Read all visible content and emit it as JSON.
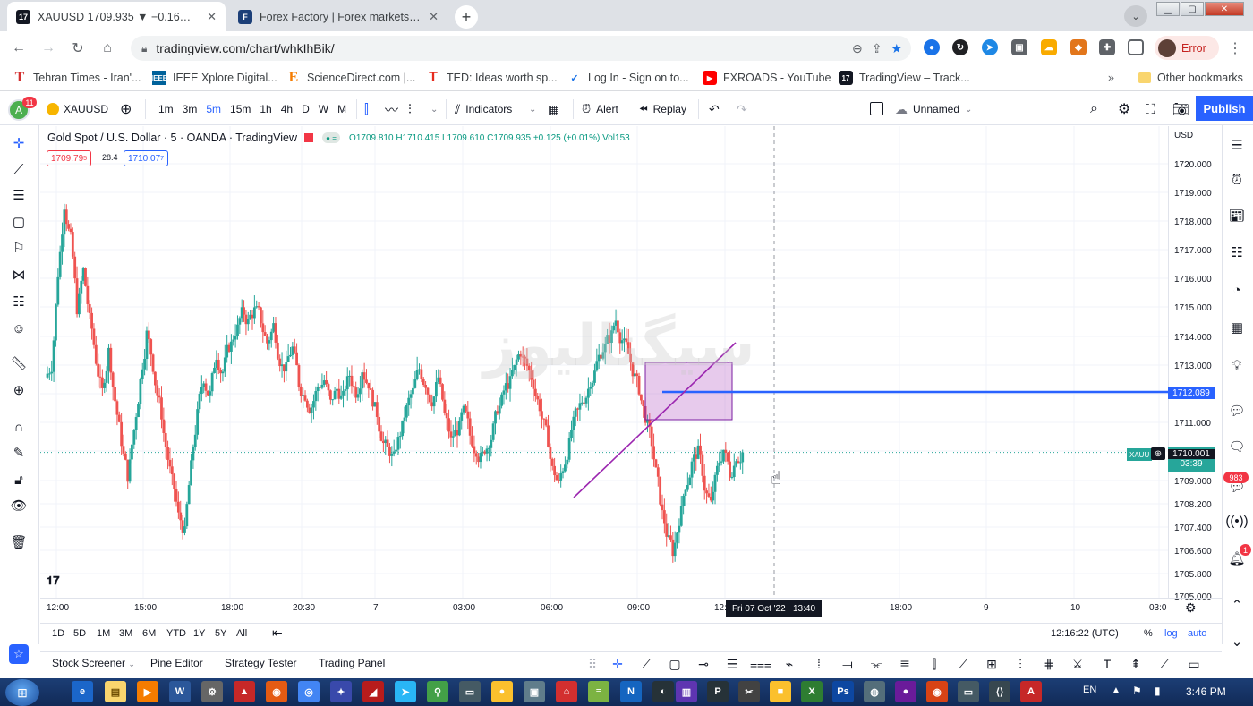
{
  "browser": {
    "tabs": [
      {
        "title": "XAUUSD 1709.935 ▼ −0.16% Un",
        "favicon": "tradingview-icon"
      },
      {
        "title": "Forex Factory | Forex markets for",
        "favicon": "forexfactory-icon"
      }
    ],
    "new_tab": "+",
    "url": "tradingview.com/chart/whkIhBik/",
    "profile_label": "Error",
    "bookmarks": [
      {
        "label": "Tehran Times - Iran'...",
        "icon": "T",
        "color": "#d32f2f"
      },
      {
        "label": "IEEE Xplore Digital...",
        "icon": "I",
        "color": "#00629b"
      },
      {
        "label": "ScienceDirect.com |...",
        "icon": "E",
        "color": "#f57c00"
      },
      {
        "label": "TED: Ideas worth sp...",
        "icon": "T",
        "color": "#e62b1e"
      },
      {
        "label": "Log In - Sign on to...",
        "icon": "✓",
        "color": "#1a73e8"
      },
      {
        "label": "FXROADS - YouTube",
        "icon": "▶",
        "color": "#ff0000"
      },
      {
        "label": "TradingView – Track...",
        "icon": "17",
        "color": "#131722"
      }
    ],
    "other_bookmarks": "Other bookmarks",
    "more": "»"
  },
  "tv_header": {
    "avatar_letter": "A",
    "avatar_badge": "11",
    "symbol": "XAUUSD",
    "intervals": [
      "1m",
      "3m",
      "5m",
      "15m",
      "1h",
      "4h",
      "D",
      "W",
      "M"
    ],
    "active_interval": "5m",
    "indicators": "Indicators",
    "alert": "Alert",
    "replay": "Replay",
    "layout_name": "Unnamed",
    "publish": "Publish"
  },
  "legend": {
    "title": "Gold Spot / U.S. Dollar · 5 · OANDA · TradingView",
    "open": "O1709.810",
    "high": "H1710.415",
    "low": "L1709.610",
    "close": "C1709.935",
    "change": "+0.125 (+0.01%)",
    "volume": "Vol153",
    "sell_price": "1709.79",
    "sell_sup": "5",
    "spread": "28.4",
    "buy_price": "1710.07",
    "buy_sup": "7"
  },
  "price_axis": {
    "currency": "USD",
    "labels": [
      "1720.000",
      "1719.000",
      "1718.000",
      "1717.000",
      "1716.000",
      "1715.000",
      "1714.000",
      "1713.000",
      "1712.000",
      "1711.000",
      "1710.000",
      "1709.000",
      "1708.200",
      "1707.400",
      "1706.600",
      "1705.800",
      "1705.000"
    ],
    "hline_label": "1712.089",
    "last_price": "1710.001",
    "countdown": "03:39",
    "symbol_tag": "XAUU"
  },
  "time_axis": {
    "labels": [
      "12:00",
      "15:00",
      "18:00",
      "20:30",
      "7",
      "03:00",
      "06:00",
      "09:00",
      "12:",
      "18:00",
      "9",
      "10",
      "03:0"
    ],
    "crosshair": "Fri 07 Oct '22   13:40"
  },
  "range_bar": {
    "ranges": [
      "1D",
      "5D",
      "1M",
      "3M",
      "6M",
      "YTD",
      "1Y",
      "5Y",
      "All"
    ],
    "time": "12:16:22 (UTC)",
    "percent": "%",
    "log": "log",
    "auto": "auto"
  },
  "bottom_tabs": [
    "Stock Screener",
    "Pine Editor",
    "Strategy Tester",
    "Trading Panel"
  ],
  "watermark": "سیگنالیوز",
  "right_badges": {
    "notifications": "983",
    "alerts": "1"
  },
  "taskbar": {
    "lang": "EN",
    "clock": "3:46 PM"
  },
  "colors": {
    "bull": "#26a69a",
    "bear": "#ef5350",
    "hline": "#2962ff",
    "trend": "#9c27b0",
    "box": "rgba(186,104,200,0.35)",
    "accent": "#2962ff"
  },
  "chart_data": {
    "type": "candlestick",
    "symbol": "XAUUSD",
    "timeframe": "5",
    "ylim": [
      1705.0,
      1720.5
    ],
    "closes": [
      1713.0,
      1716.2,
      1718.6,
      1717.4,
      1715.0,
      1716.3,
      1714.6,
      1713.2,
      1712.1,
      1713.5,
      1711.8,
      1710.4,
      1709.2,
      1710.8,
      1712.5,
      1714.1,
      1713.0,
      1711.7,
      1710.2,
      1709.0,
      1707.8,
      1707.2,
      1709.5,
      1711.3,
      1712.6,
      1712.0,
      1713.4,
      1712.8,
      1713.7,
      1714.2,
      1714.8,
      1714.5,
      1714.9,
      1714.6,
      1713.8,
      1714.4,
      1713.2,
      1712.9,
      1713.6,
      1712.4,
      1712.0,
      1711.6,
      1712.3,
      1712.5,
      1711.7,
      1712.2,
      1711.9,
      1712.7,
      1712.1,
      1712.9,
      1712.4,
      1711.5,
      1710.6,
      1710.1,
      1709.8,
      1710.7,
      1711.5,
      1712.1,
      1712.9,
      1712.4,
      1711.8,
      1712.6,
      1711.3,
      1710.4,
      1710.8,
      1711.4,
      1710.6,
      1710.1,
      1709.9,
      1710.4,
      1711.2,
      1711.8,
      1712.4,
      1712.9,
      1713.5,
      1713.0,
      1712.4,
      1711.6,
      1710.7,
      1709.4,
      1708.9,
      1709.7,
      1710.8,
      1711.4,
      1711.9,
      1712.5,
      1713.1,
      1713.6,
      1714.0,
      1714.6,
      1713.9,
      1713.4,
      1712.6,
      1711.8,
      1710.9,
      1709.8,
      1708.4,
      1707.2,
      1706.6,
      1707.7,
      1708.9,
      1709.6,
      1710.0,
      1708.8,
      1708.2,
      1709.4,
      1710.1,
      1709.3,
      1709.9,
      1710.0
    ]
  }
}
